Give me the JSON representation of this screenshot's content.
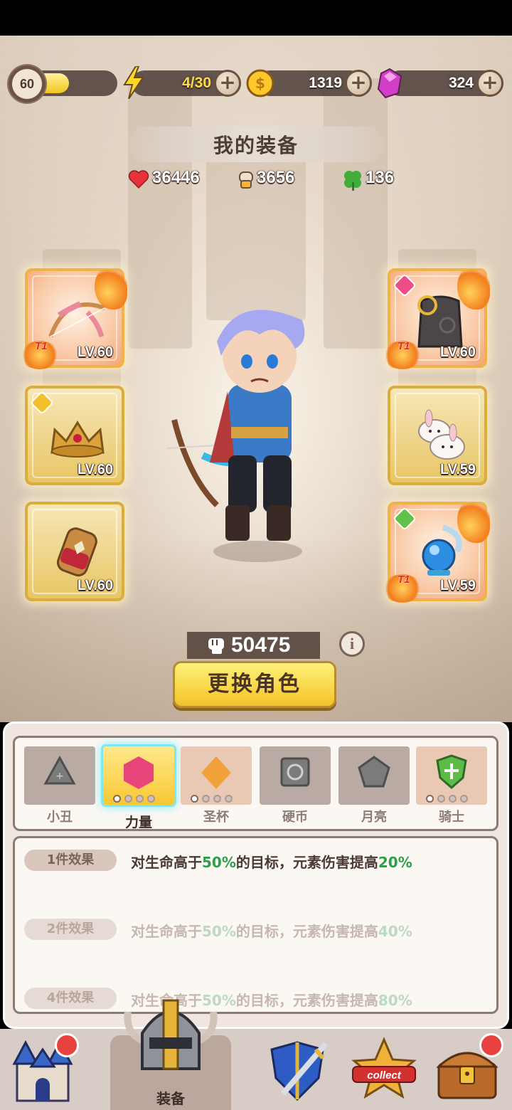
{
  "top_bar": {
    "level": "60",
    "energy": "4/30",
    "coins": "1319",
    "gems": "324",
    "xp_fraction": 0.45
  },
  "header": {
    "title": "我的装备"
  },
  "stats": {
    "hp": "36446",
    "attack": "3656",
    "luck": "136"
  },
  "slots": [
    {
      "level": "LV.60",
      "tier": "T1"
    },
    {
      "level": "LV.60",
      "tier": ""
    },
    {
      "level": "LV.60",
      "tier": ""
    },
    {
      "level": "LV.60",
      "tier": "T1"
    },
    {
      "level": "LV.59",
      "tier": ""
    },
    {
      "level": "LV.59",
      "tier": "T1"
    }
  ],
  "power": "50475",
  "change_button": "更换角色",
  "set_tabs": [
    {
      "label": "小丑",
      "color": "#9e9e9e",
      "icon": "drop-icon"
    },
    {
      "label": "力量",
      "color": "#e8457a",
      "icon": "pink-hex-icon"
    },
    {
      "label": "圣杯",
      "color": "#f0a13a",
      "icon": "goblet-icon"
    },
    {
      "label": "硬币",
      "color": "#9e9e9e",
      "icon": "coin-icon"
    },
    {
      "label": "月亮",
      "color": "#9e9e9e",
      "icon": "moon-icon"
    },
    {
      "label": "骑士",
      "color": "#5dbb47",
      "icon": "shield-icon"
    }
  ],
  "effects": [
    {
      "badge": "1件效果",
      "pre": "对生命高于",
      "pct1": "50%",
      "mid": "的目标，元素伤害提高",
      "pct2": "20%"
    },
    {
      "badge": "2件效果",
      "pre": "对生命高于",
      "pct1": "50%",
      "mid": "的目标，元素伤害提高",
      "pct2": "40%"
    },
    {
      "badge": "4件效果",
      "pre": "对生命高于",
      "pct1": "50%",
      "mid": "的目标，元素伤害提高",
      "pct2": "80%"
    }
  ],
  "bottom_nav": {
    "active_label": "装备",
    "collect_label": "collect"
  }
}
